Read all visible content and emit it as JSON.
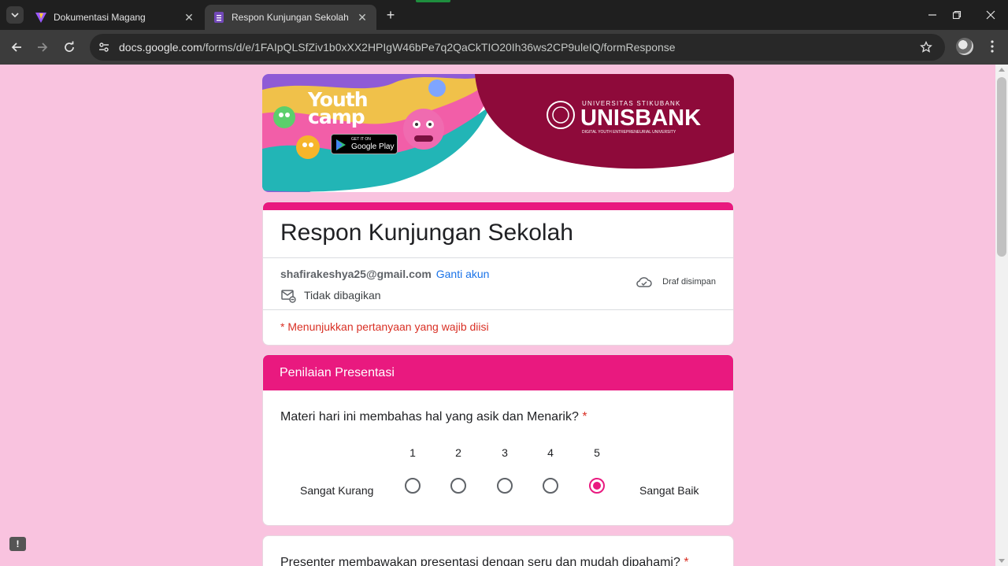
{
  "browser": {
    "tabs": [
      {
        "title": "Dokumentasi Magang",
        "active": false,
        "icon": "vite-icon"
      },
      {
        "title": "Respon Kunjungan Sekolah",
        "active": true,
        "icon": "google-forms-icon"
      }
    ],
    "new_tab_symbol": "+",
    "close_symbol": "✕",
    "url_host": "docs.google.com",
    "url_path": "/forms/d/e/1FAIpQLSfZiv1b0xXX2HPIgW46bPe7q2QaCkTIO20Ih36ws2CP9uleIQ/formResponse",
    "colors": {
      "chrome_dark": "#1f1f1f",
      "toolbar": "#3c3c3c",
      "omnibox": "#282828"
    }
  },
  "banner": {
    "left_logo": "Youth camp",
    "play_badge_small": "GET IT ON",
    "play_badge": "Google Play",
    "university_line": "UNIVERSITAS STIKUBANK",
    "university_name": "UNISBANK",
    "university_tagline": "DIGITAL YOUTH ENTREPRENEURIAL UNIVERSITY"
  },
  "form": {
    "title": "Respon Kunjungan Sekolah",
    "account_email": "shafirakeshya25@gmail.com",
    "switch_account": "Ganti akun",
    "not_shared": "Tidak dibagikan",
    "draft_saved": "Draf disimpan",
    "required_note": "* Menunjukkan pertanyaan yang wajib diisi",
    "accent": "#e9197f",
    "page_background": "#f9c3df"
  },
  "section": {
    "title": "Penilaian Presentasi",
    "question": "Materi hari ini membahas hal yang asik dan Menarik?",
    "required_mark": "*",
    "scale_low_label": "Sangat Kurang",
    "scale_high_label": "Sangat Baik",
    "scale": [
      "1",
      "2",
      "3",
      "4",
      "5"
    ],
    "selected": "5"
  },
  "next_question": {
    "text": "Presenter membawakan presentasi dengan seru dan mudah dipahami?",
    "required_mark": "*"
  },
  "feedback_symbol": "!"
}
